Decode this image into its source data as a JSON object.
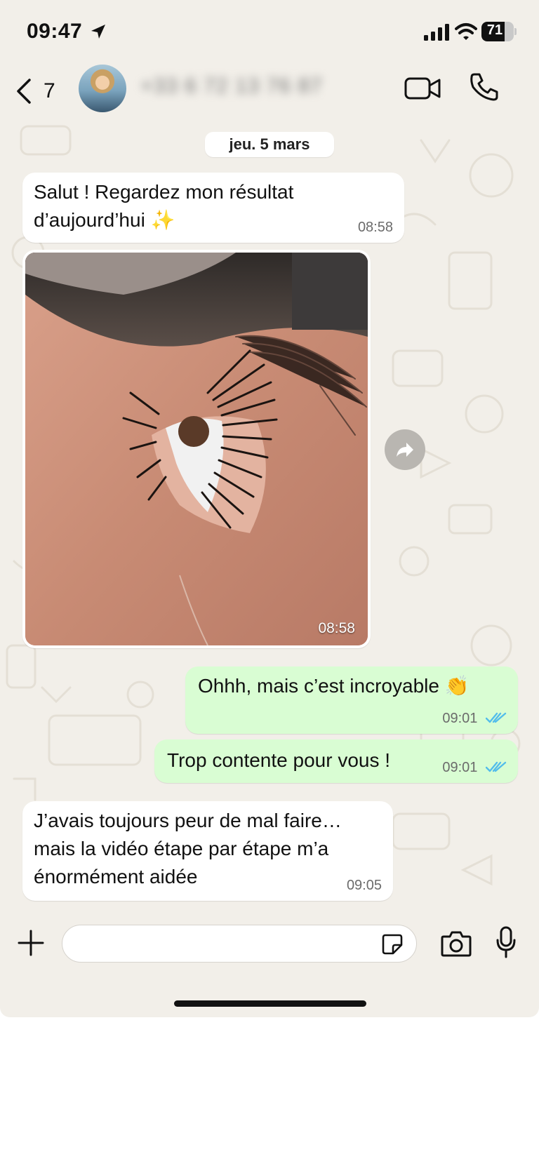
{
  "status_bar": {
    "time": "09:47",
    "battery": "71",
    "battery_level": 0.71
  },
  "header": {
    "back_count": "7",
    "contact_name": "+33 6 72 13 76 87"
  },
  "date_chip": "jeu. 5 mars",
  "messages": [
    {
      "direction": "in",
      "text": "Salut ! Regardez mon résultat d’aujourd’hui ✨",
      "time": "08:58"
    },
    {
      "direction": "in",
      "type": "image",
      "description": "",
      "time": "08:58"
    },
    {
      "direction": "out",
      "text": "Ohhh, mais c’est incroyable 👏",
      "time": "09:01",
      "read": true
    },
    {
      "direction": "out",
      "text": "Trop contente pour vous !",
      "time": "09:01",
      "read": true
    },
    {
      "direction": "in",
      "text": "J’avais toujours peur de mal faire… mais la vidéo étape par étape m’a énormément aidée",
      "time": "09:05"
    }
  ],
  "composer": {
    "value": "",
    "placeholder": ""
  },
  "colors": {
    "background": "#f2efe9",
    "outgoing_bubble": "#d9fdd3",
    "incoming_bubble": "#ffffff",
    "read_ticks": "#53bdeb"
  },
  "icons": [
    "location-arrow-icon",
    "signal-icon",
    "wifi-icon",
    "battery-icon",
    "back-chevron-icon",
    "video-call-icon",
    "phone-icon",
    "forward-icon",
    "plus-icon",
    "sticker-icon",
    "camera-icon",
    "mic-icon"
  ]
}
